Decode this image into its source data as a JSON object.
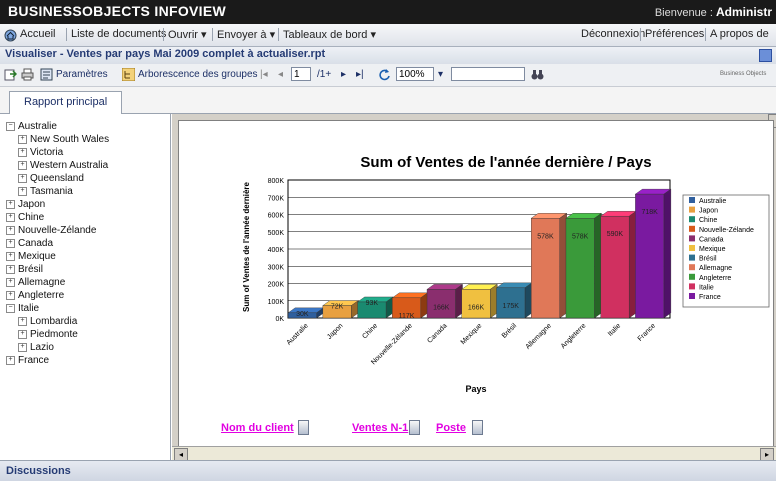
{
  "app": {
    "title": "BUSINESSOBJECTS INFOVIEW",
    "welcome_label": "Bienvenue :",
    "welcome_user": "Administr"
  },
  "menu": {
    "home": "Accueil",
    "doc_list": "Liste de documents",
    "open": "Ouvrir ▾",
    "send_to": "Envoyer à ▾",
    "dashboards": "Tableaux de bord ▾",
    "logout": "Déconnexion",
    "preferences": "Préférences",
    "about": "A propos de"
  },
  "document": {
    "title": "Visualiser - Ventes par pays Mai 2009 complet à actualiser.rpt"
  },
  "toolbar": {
    "params_label": "Paramètres",
    "group_tree_label": "Arborescence des groupes",
    "page_value": "1",
    "page_total": "/1+",
    "zoom_value": "100%",
    "search_value": "",
    "brand_label": "Business Objects"
  },
  "tabs": {
    "main": "Rapport principal"
  },
  "tree": [
    {
      "label": "Australie",
      "level": 0,
      "expanded": true
    },
    {
      "label": "New South Wales",
      "level": 1,
      "expanded": false
    },
    {
      "label": "Victoria",
      "level": 1,
      "expanded": false
    },
    {
      "label": "Western Australia",
      "level": 1,
      "expanded": false
    },
    {
      "label": "Queensland",
      "level": 1,
      "expanded": false
    },
    {
      "label": "Tasmania",
      "level": 1,
      "expanded": false
    },
    {
      "label": "Japon",
      "level": 0,
      "expanded": false
    },
    {
      "label": "Chine",
      "level": 0,
      "expanded": false
    },
    {
      "label": "Nouvelle-Zélande",
      "level": 0,
      "expanded": false
    },
    {
      "label": "Canada",
      "level": 0,
      "expanded": false
    },
    {
      "label": "Mexique",
      "level": 0,
      "expanded": false
    },
    {
      "label": "Brésil",
      "level": 0,
      "expanded": false
    },
    {
      "label": "Allemagne",
      "level": 0,
      "expanded": false
    },
    {
      "label": "Angleterre",
      "level": 0,
      "expanded": false
    },
    {
      "label": "Italie",
      "level": 0,
      "expanded": true
    },
    {
      "label": "Lombardia",
      "level": 1,
      "expanded": false
    },
    {
      "label": "Piedmonte",
      "level": 1,
      "expanded": false
    },
    {
      "label": "Lazio",
      "level": 1,
      "expanded": false
    },
    {
      "label": "France",
      "level": 0,
      "expanded": false
    }
  ],
  "chart_data": {
    "type": "bar",
    "title": "Sum of Ventes de l'année dernière / Pays",
    "xlabel": "Pays",
    "ylabel": "Sum of Ventes de l'année dernière",
    "ylim": [
      0,
      800000
    ],
    "yticks": [
      "0K",
      "100K",
      "200K",
      "300K",
      "400K",
      "500K",
      "600K",
      "700K",
      "800K"
    ],
    "categories": [
      "Australie",
      "Japon",
      "Chine",
      "Nouvelle-Zélande",
      "Canada",
      "Mexique",
      "Brésil",
      "Allemagne",
      "Angleterre",
      "Italie",
      "France"
    ],
    "values": [
      30000,
      72000,
      93000,
      117000,
      166000,
      166000,
      175000,
      578000,
      578000,
      590000,
      718000
    ],
    "data_labels": [
      "30K",
      "72K",
      "93K",
      "117K",
      "166K",
      "166K",
      "175K",
      "578K",
      "578K",
      "590K",
      "718K"
    ],
    "colors": [
      "#2f5f9e",
      "#e8a040",
      "#1a8a70",
      "#d85a1a",
      "#8a2e6e",
      "#f0c040",
      "#2e7090",
      "#e07858",
      "#3a9a3a",
      "#d03060",
      "#7a1aa0"
    ],
    "legend": [
      "Australie",
      "Japon",
      "Chine",
      "Nouvelle-Zélande",
      "Canada",
      "Mexique",
      "Brésil",
      "Allemagne",
      "Angleterre",
      "Italie",
      "France"
    ],
    "legend_position": "right",
    "grid": true,
    "style": "3d"
  },
  "report_fields": {
    "client": "Nom du client",
    "sales": "Ventes N-1",
    "position": "Poste"
  },
  "status": {
    "discussions": "Discussions"
  }
}
